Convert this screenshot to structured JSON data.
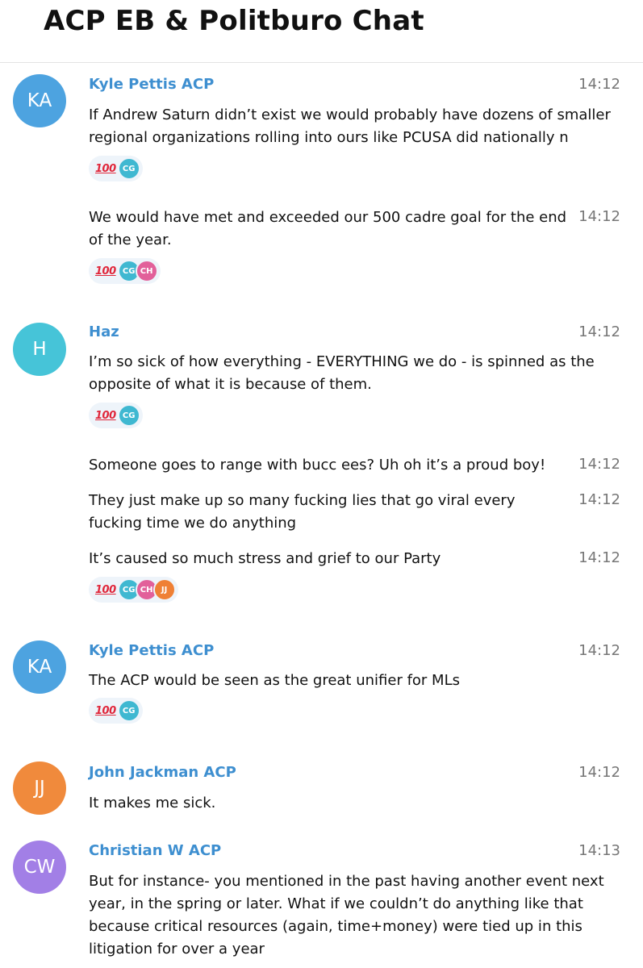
{
  "header": {
    "title": "ACP EB & Politburo Chat"
  },
  "avatar_colors": {
    "KA": "#4da3e0",
    "H": "#46c4d8",
    "JJ": "#f08a3c",
    "CW": "#a27fe6"
  },
  "messages": [
    {
      "avatar": "KA",
      "sender": "Kyle Pettis ACP",
      "time": "14:12",
      "text": "If Andrew Saturn didn’t exist we would probably have dozens of smaller regional organizations rolling into ours like PCUSA did nationally n",
      "reactions": {
        "emoji": "💯",
        "emoji_icon": "hundred-points-icon",
        "users": [
          "CG"
        ]
      }
    },
    {
      "time": "14:12",
      "text": "We would have met and exceeded our 500 cadre goal for the end of the year.",
      "reactions": {
        "emoji": "💯",
        "emoji_icon": "hundred-points-icon",
        "users": [
          "CG",
          "CH"
        ]
      }
    },
    {
      "avatar": "H",
      "sender": "Haz",
      "time": "14:12",
      "text": "I’m so sick of how everything - EVERYTHING we do - is spinned as the opposite of what it is because of them.",
      "reactions": {
        "emoji": "💯",
        "emoji_icon": "hundred-points-icon",
        "users": [
          "CG"
        ]
      }
    },
    {
      "time": "14:12",
      "text": "Someone goes to range with bucc ees? Uh oh it’s a proud boy!"
    },
    {
      "time": "14:12",
      "text": "They just make up so many fucking lies that go viral every fucking time we do anything"
    },
    {
      "time": "14:12",
      "text": "It’s caused so much stress and grief to our Party",
      "reactions": {
        "emoji": "💯",
        "emoji_icon": "hundred-points-icon",
        "users": [
          "CG",
          "CH",
          "JJ"
        ]
      }
    },
    {
      "avatar": "KA",
      "sender": "Kyle Pettis ACP",
      "time": "14:12",
      "text": "The ACP would be seen as the great unifier for MLs",
      "reactions": {
        "emoji": "💯",
        "emoji_icon": "hundred-points-icon",
        "users": [
          "CG"
        ]
      }
    },
    {
      "avatar": "JJ",
      "sender": "John Jackman ACP",
      "time": "14:12",
      "text": "It makes me sick."
    },
    {
      "avatar": "CW",
      "sender": "Christian W ACP",
      "time": "14:13",
      "text": "But for instance- you mentioned in the past having another event next year, in the spring or later. What if we couldn’t do anything like that because critical resources (again, time+money) were tied up in this litigation for over a year"
    }
  ]
}
